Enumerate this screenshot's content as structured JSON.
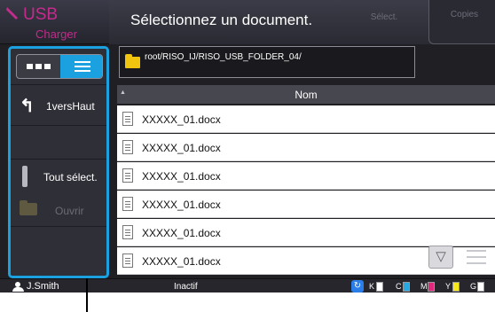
{
  "app": {
    "title": "USB",
    "subtitle": "Charger",
    "accent": "#c42b8c"
  },
  "header": {
    "message": "Sélectionnez un document.",
    "tab_select": "Sélect.",
    "tab_copies": "Copies"
  },
  "left_panel": {
    "highlight_color": "#1ba0e0",
    "view_toggle": {
      "thumbnail": "thumbnail-view-icon",
      "list": "list-view-icon",
      "selected": "list"
    },
    "up_label": "1versHaut",
    "select_all_label": "Tout sélect.",
    "open_label": "Ouvrir"
  },
  "path": {
    "text": "root/RISO_IJ/RISO_USB_FOLDER_04/"
  },
  "table": {
    "column_header": "Nom",
    "rows": [
      "XXXXX_01.docx",
      "XXXXX_01.docx",
      "XXXXX_01.docx",
      "XXXXX_01.docx",
      "XXXXX_01.docx",
      "XXXXX_01.docx"
    ]
  },
  "footer": {
    "user": "J.Smith",
    "status": "Inactif",
    "inks": [
      {
        "label": "K",
        "color": "#ffffff"
      },
      {
        "label": "C",
        "color": "#29a9e1"
      },
      {
        "label": "M",
        "color": "#e0287d"
      },
      {
        "label": "Y",
        "color": "#f7e81a"
      },
      {
        "label": "G",
        "color": "#ffffff"
      }
    ]
  }
}
